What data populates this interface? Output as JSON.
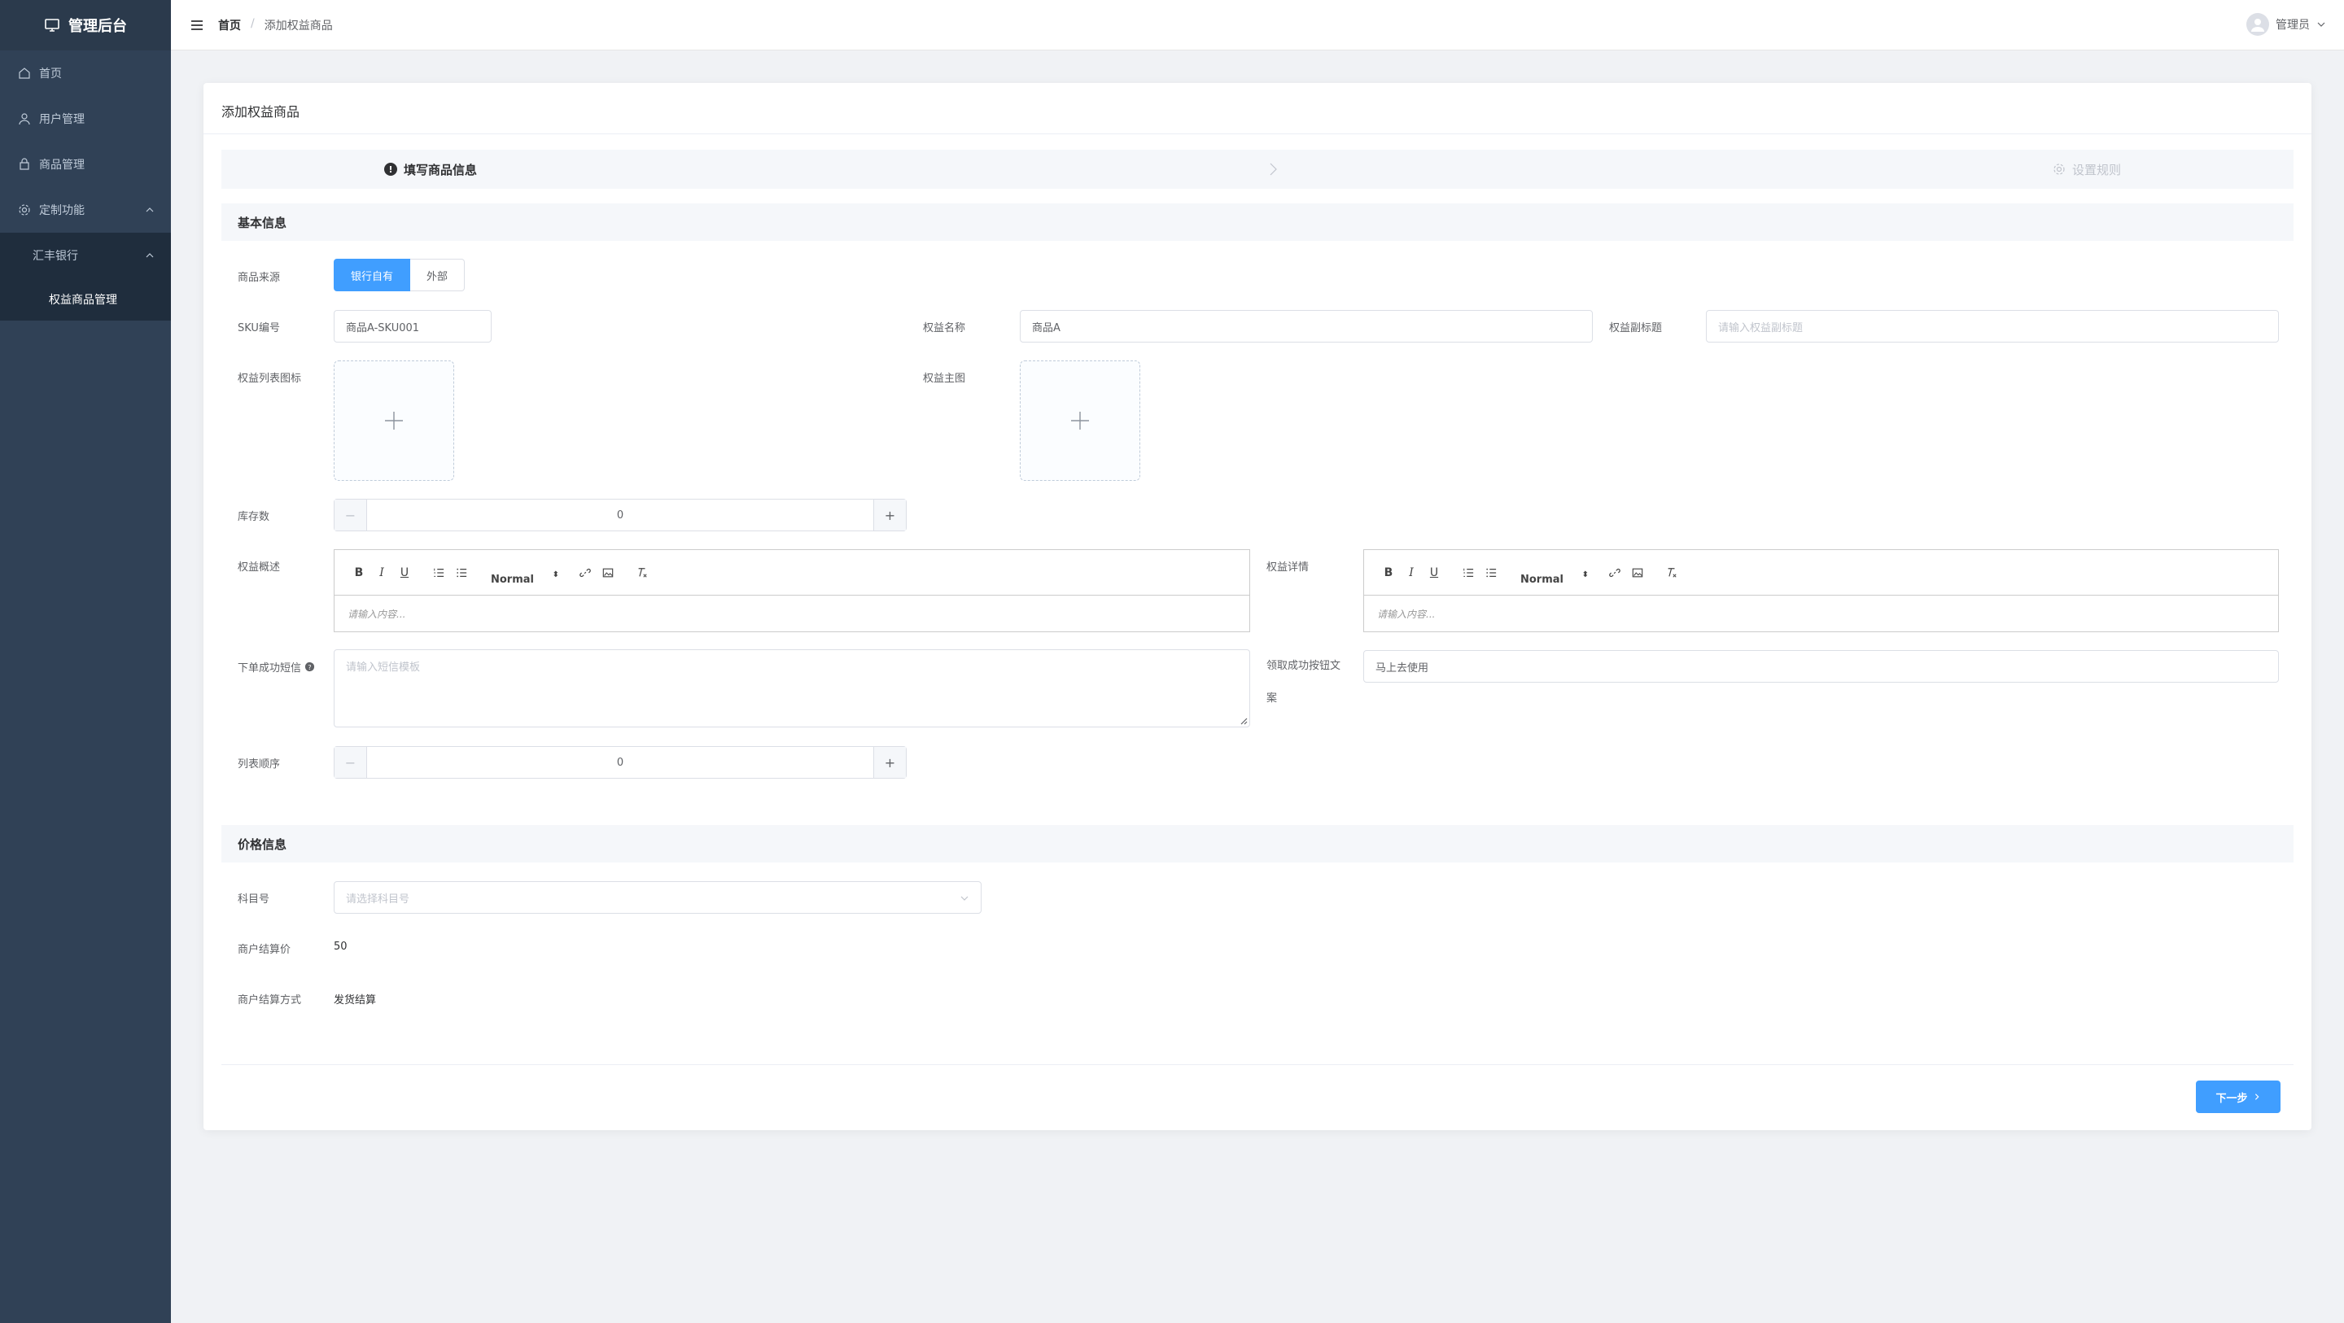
{
  "sidebar": {
    "title": "管理后台",
    "items": [
      {
        "label": "首页",
        "icon": "home-icon"
      },
      {
        "label": "用户管理",
        "icon": "user-icon"
      },
      {
        "label": "商品管理",
        "icon": "shop-icon"
      },
      {
        "label": "定制功能",
        "icon": "gear-icon"
      },
      {
        "label": "汇丰银行"
      },
      {
        "label": "权益商品管理"
      }
    ]
  },
  "header": {
    "breadcrumb_home": "首页",
    "breadcrumb_sep": "/",
    "breadcrumb_current": "添加权益商品",
    "user_name": "管理员"
  },
  "page": {
    "title": "添加权益商品"
  },
  "steps": {
    "step1": "填写商品信息",
    "step2": "设置规则"
  },
  "basic": {
    "section_title": "基本信息",
    "source_label": "商品来源",
    "source_options": [
      "银行自有",
      "外部"
    ],
    "sku_label": "SKU编号",
    "sku_value": "商品A-SKU001",
    "name_label": "权益名称",
    "name_value": "商品A",
    "subtitle_label": "权益副标题",
    "subtitle_placeholder": "请输入权益副标题",
    "list_icon_label": "权益列表图标",
    "main_image_label": "权益主图",
    "stock_label": "库存数",
    "stock_value": "0",
    "overview_label": "权益概述",
    "detail_label": "权益详情",
    "editor_format": "Normal",
    "editor_placeholder": "请输入内容...",
    "sms_label": "下单成功短信",
    "sms_placeholder": "请输入短信模板",
    "button_text_label_1": "领取成功按钮文",
    "button_text_label_2": "案",
    "button_text_value": "马上去使用",
    "order_label": "列表顺序",
    "order_value": "0"
  },
  "price": {
    "section_title": "价格信息",
    "account_label": "科目号",
    "account_placeholder": "请选择科目号",
    "settle_price_label": "商户结算价",
    "settle_price_value": "50",
    "settle_method_label": "商户结算方式",
    "settle_method_value": "发货结算"
  },
  "footer": {
    "next_label": "下一步"
  },
  "colors": {
    "sidebar_bg": "#304156",
    "primary": "#409eff"
  }
}
